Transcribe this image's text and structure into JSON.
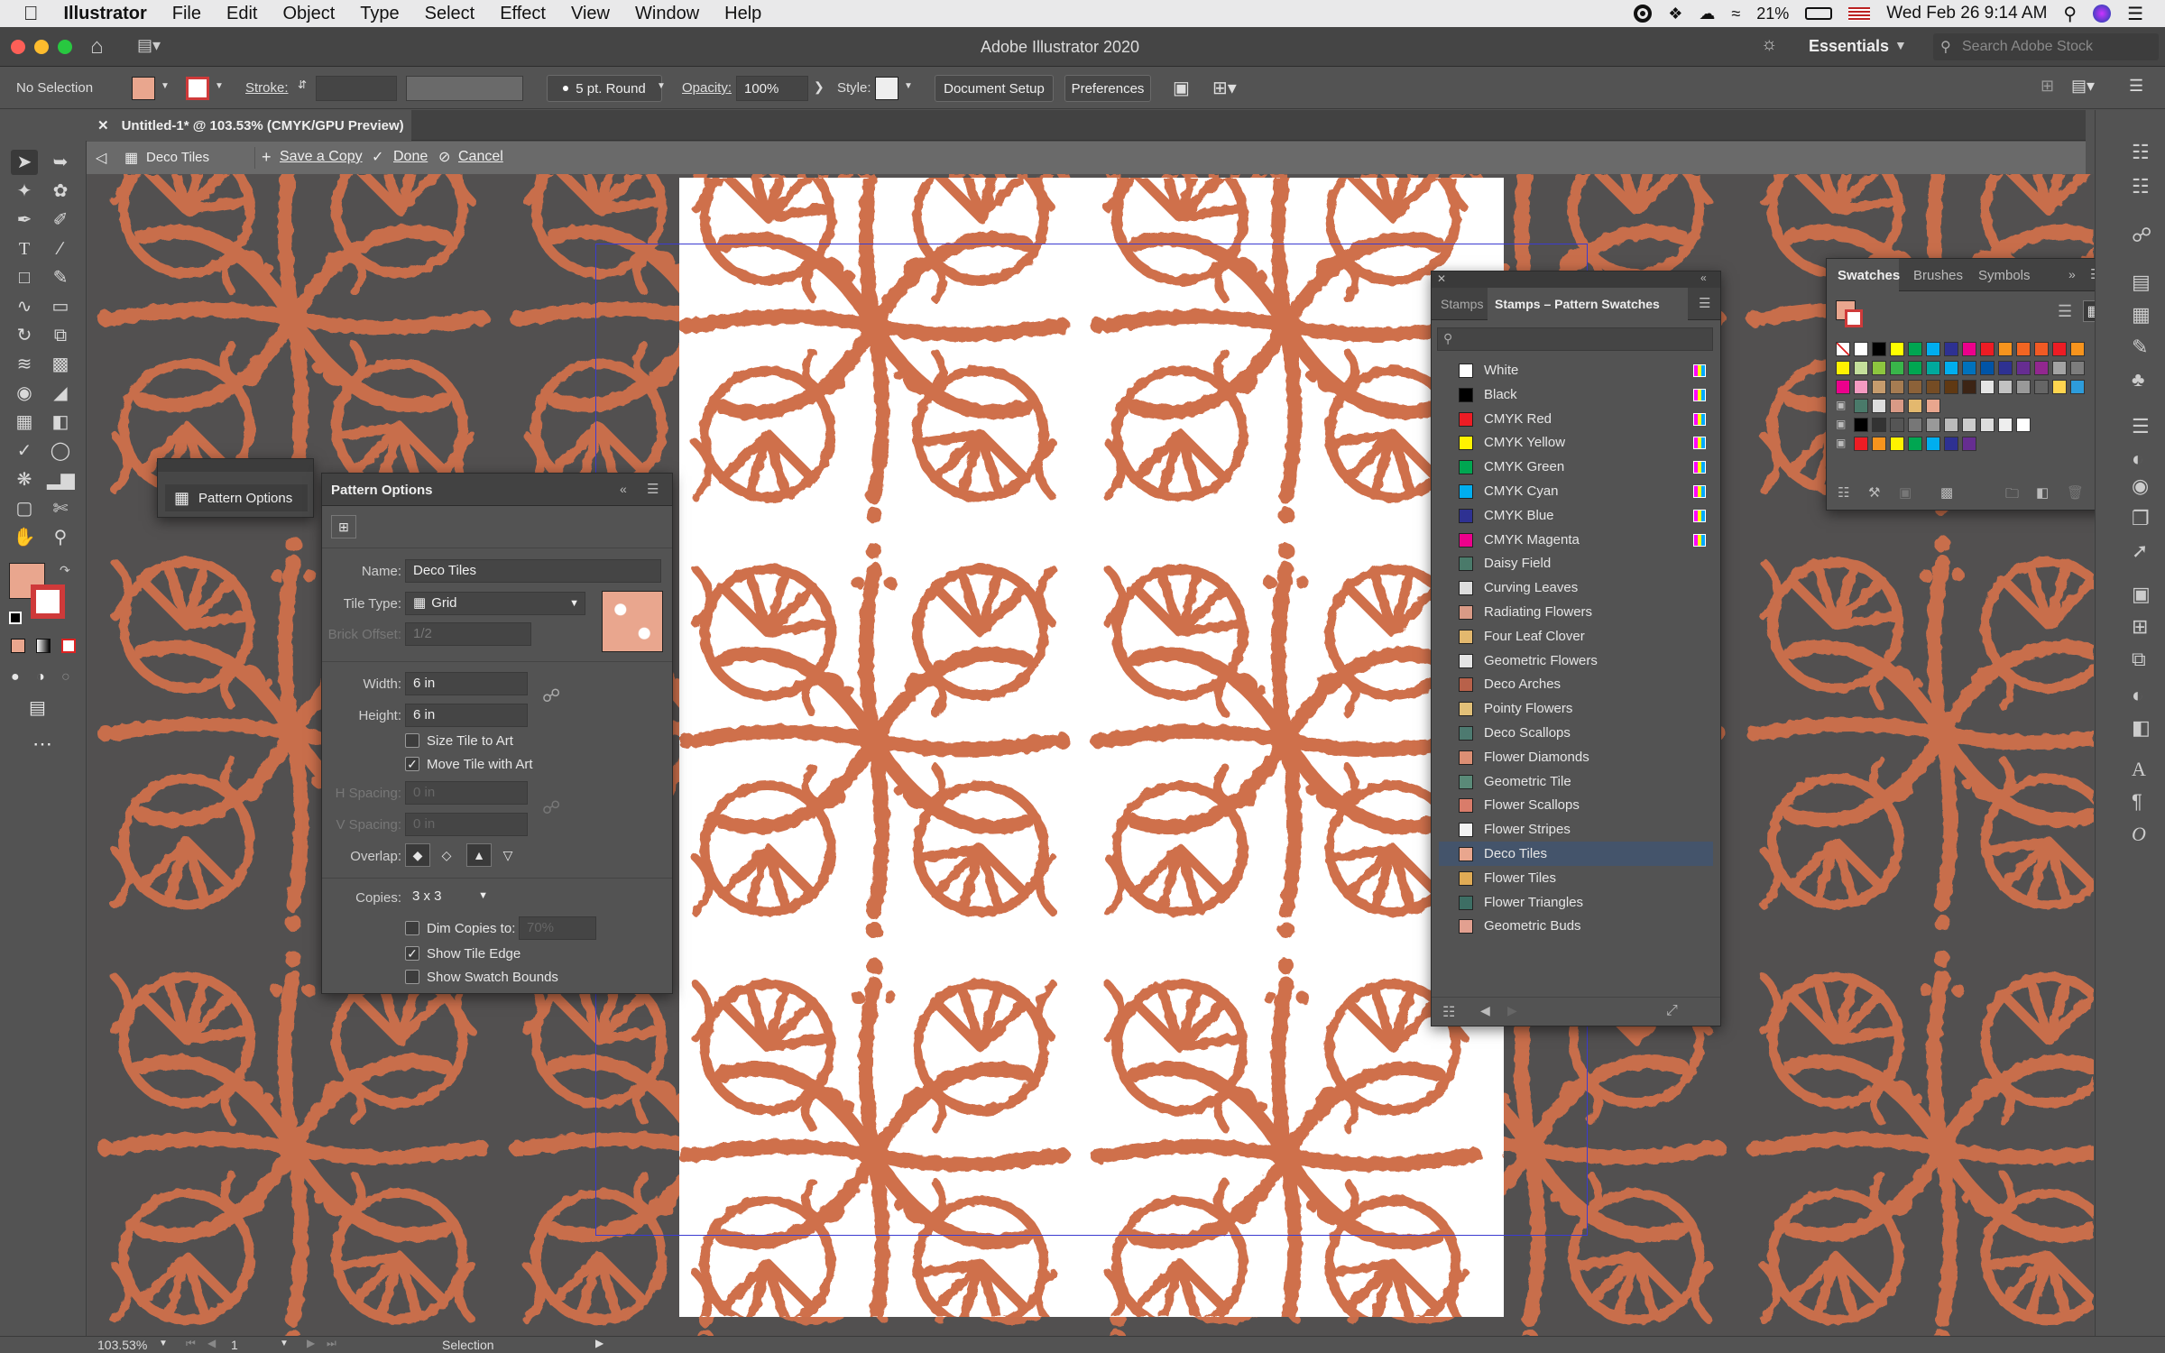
{
  "menubar": {
    "app": "Illustrator",
    "items": [
      "File",
      "Edit",
      "Object",
      "Type",
      "Select",
      "Effect",
      "View",
      "Window",
      "Help"
    ],
    "battery": "21%",
    "clock": "Wed Feb 26  9:14 AM"
  },
  "window": {
    "title": "Adobe Illustrator 2020",
    "workspace": "Essentials",
    "search_placeholder": "Search Adobe Stock"
  },
  "controlbar": {
    "selection": "No Selection",
    "stroke_label": "Stroke:",
    "brush": "5 pt. Round",
    "opacity_label": "Opacity:",
    "opacity": "100%",
    "style_label": "Style:",
    "document_setup": "Document Setup",
    "preferences": "Preferences"
  },
  "document": {
    "tab": "Untitled-1* @ 103.53% (CMYK/GPU Preview)"
  },
  "isolation": {
    "name": "Deco Tiles",
    "save_copy": "Save a Copy",
    "done": "Done",
    "cancel": "Cancel"
  },
  "pattern_options_collapsed": {
    "label": "Pattern Options"
  },
  "pattern_options": {
    "title": "Pattern Options",
    "name_label": "Name:",
    "name": "Deco Tiles",
    "tile_type_label": "Tile Type:",
    "tile_type": "Grid",
    "brick_offset_label": "Brick Offset:",
    "brick_offset": "1/2",
    "width_label": "Width:",
    "width": "6 in",
    "height_label": "Height:",
    "height": "6 in",
    "size_tile_to_art": "Size Tile to Art",
    "move_tile_with_art": "Move Tile with Art",
    "h_spacing_label": "H Spacing:",
    "h_spacing": "0 in",
    "v_spacing_label": "V Spacing:",
    "v_spacing": "0 in",
    "overlap_label": "Overlap:",
    "copies_label": "Copies:",
    "copies": "3 x 3",
    "dim_copies": "Dim Copies to:",
    "dim_value": "70%",
    "show_tile_edge": "Show Tile Edge",
    "show_swatch_bounds": "Show Swatch Bounds"
  },
  "stamps_panel": {
    "tab_short": "Stamps",
    "tab_active": "Stamps – Pattern Swatches",
    "swatches": [
      {
        "name": "White",
        "color": "#ffffff",
        "cmyk": true
      },
      {
        "name": "Black",
        "color": "#000000",
        "cmyk": true
      },
      {
        "name": "CMYK Red",
        "color": "#ed1c24",
        "cmyk": true
      },
      {
        "name": "CMYK Yellow",
        "color": "#fff200",
        "cmyk": true
      },
      {
        "name": "CMYK Green",
        "color": "#00a651",
        "cmyk": true
      },
      {
        "name": "CMYK Cyan",
        "color": "#00aeef",
        "cmyk": true
      },
      {
        "name": "CMYK Blue",
        "color": "#2e3192",
        "cmyk": true
      },
      {
        "name": "CMYK Magenta",
        "color": "#ec008c",
        "cmyk": true
      },
      {
        "name": "Daisy Field",
        "color": "#4a7a6a",
        "cmyk": false
      },
      {
        "name": "Curving Leaves",
        "color": "#dddddd",
        "cmyk": false
      },
      {
        "name": "Radiating Flowers",
        "color": "#d99a86",
        "cmyk": false
      },
      {
        "name": "Four Leaf Clover",
        "color": "#e3b86e",
        "cmyk": false
      },
      {
        "name": "Geometric Flowers",
        "color": "#e4e4e4",
        "cmyk": false
      },
      {
        "name": "Deco Arches",
        "color": "#b8614a",
        "cmyk": false
      },
      {
        "name": "Pointy Flowers",
        "color": "#e2c078",
        "cmyk": false
      },
      {
        "name": "Deco Scallops",
        "color": "#4d7a70",
        "cmyk": false
      },
      {
        "name": "Flower Diamonds",
        "color": "#dc8f74",
        "cmyk": false
      },
      {
        "name": "Geometric Tile",
        "color": "#5a8a78",
        "cmyk": false
      },
      {
        "name": "Flower Scallops",
        "color": "#d97c6a",
        "cmyk": false
      },
      {
        "name": "Flower Stripes",
        "color": "#f2f2f2",
        "cmyk": false
      },
      {
        "name": "Deco Tiles",
        "color": "#e9a68e",
        "cmyk": false,
        "selected": true
      },
      {
        "name": "Flower Tiles",
        "color": "#e0ab55",
        "cmyk": false
      },
      {
        "name": "Flower Triangles",
        "color": "#3d6e64",
        "cmyk": false
      },
      {
        "name": "Geometric Buds",
        "color": "#e2a090",
        "cmyk": false
      }
    ]
  },
  "swatches_panel": {
    "tabs": [
      "Swatches",
      "Brushes",
      "Symbols"
    ]
  },
  "status": {
    "zoom": "103.53%",
    "artboard": "1",
    "mode": "Selection"
  },
  "colors": {
    "pattern": "#cf6f4c",
    "pattern_light": "#e59b7a",
    "canvas": "#525050"
  }
}
